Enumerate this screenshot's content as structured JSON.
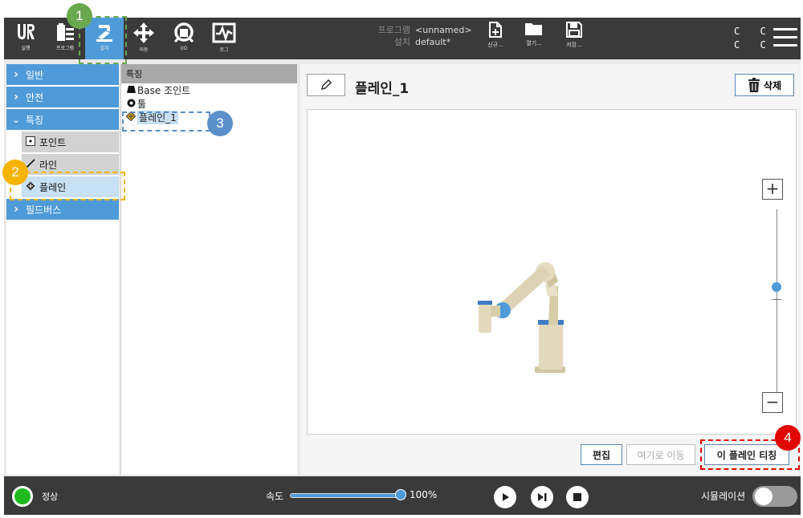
{
  "header": {
    "nav": [
      {
        "label": "실행",
        "icon": "ur-logo-icon"
      },
      {
        "label": "프로그램",
        "icon": "program-icon"
      },
      {
        "label": "설치",
        "icon": "installation-icon"
      },
      {
        "label": "이동",
        "icon": "move-icon"
      },
      {
        "label": "I/O",
        "icon": "io-icon"
      },
      {
        "label": "로그",
        "icon": "log-icon"
      }
    ],
    "program_key": "프로그램",
    "program_value": "<unnamed>",
    "installation_key": "설치",
    "installation_value": "default*",
    "file": [
      {
        "label": "신규...",
        "icon": "new-file-icon"
      },
      {
        "label": "열기...",
        "icon": "open-folder-icon"
      },
      {
        "label": "저장...",
        "icon": "save-icon"
      }
    ],
    "cc_top": "C C",
    "cc_bottom": "C C"
  },
  "sidebar": {
    "items": [
      {
        "label": "일반"
      },
      {
        "label": "안전"
      },
      {
        "label": "특징"
      },
      {
        "label": "필드버스"
      }
    ],
    "sub_items": [
      {
        "label": "포인트"
      },
      {
        "label": "라인"
      },
      {
        "label": "플레인"
      }
    ]
  },
  "tree": {
    "header": "특징",
    "items": [
      {
        "label": "Base 조인트"
      },
      {
        "label": "툴"
      },
      {
        "label": "플레인_1"
      }
    ]
  },
  "main": {
    "title": "플레인_1",
    "delete_label": "삭제",
    "zoom_in": "+",
    "zoom_out": "−",
    "edit_label": "편집",
    "move_here_label": "여기로 이동",
    "teach_label": "이 플레인 티칭"
  },
  "footer": {
    "status": "정상",
    "speed_label": "속도",
    "speed_value": "100%",
    "simulation_label": "시뮬레이션"
  },
  "annotations": [
    "1",
    "2",
    "3",
    "4"
  ],
  "colors": {
    "accent": "#4f9bd9",
    "header_bg": "#3a3a3a",
    "ann_green": "#6aa84f",
    "ann_orange": "#f6b400",
    "ann_blue": "#5b8fc9",
    "ann_red": "#e10600"
  }
}
